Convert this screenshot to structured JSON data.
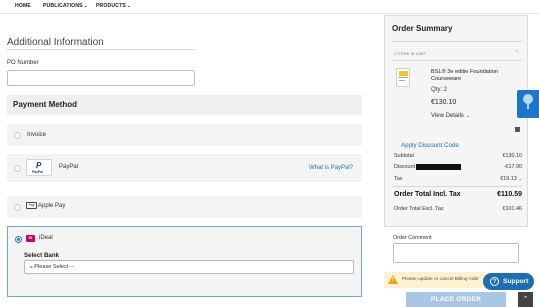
{
  "nav": {
    "home": "HOME",
    "publications": "PUBLICATIONS",
    "products": "PRODUCTS"
  },
  "additional_info": {
    "title": "Additional Information",
    "po_label": "PO Number",
    "po_value": ""
  },
  "payment": {
    "header": "Payment Method",
    "invoice": "Invoice",
    "paypal": "PayPal",
    "paypal_logo_text": "PayPal",
    "what_is_paypal": "What is PayPal?",
    "apple_pay": "Apple Pay",
    "apple_pay_logo": "Pay",
    "ideal": "iDeal",
    "ideal_logo": "iD",
    "select_bank_label": "Select Bank",
    "select_bank_value": "-- Please Select --",
    "selected": "iDeal"
  },
  "order_summary": {
    "title": "Order Summary",
    "items_in_cart": "2 ITEMS IN CART",
    "product": {
      "name": "BSL® 3e editie Foundation Courseware",
      "qty": "Qty: 2",
      "price": "€130.10",
      "view_details": "View Details"
    },
    "discount_link": "Apply Discount Code",
    "subtotal_label": "Subtotal",
    "subtotal_value": "€130.10",
    "discount_label": "Discount",
    "discount_value": "-€17.90",
    "tax_label": "Tax",
    "tax_value": "€19.13",
    "total_incl_label": "Order Total Incl. Tax",
    "total_incl_value": "€110.59",
    "total_excl_label": "Order Total Excl. Tax",
    "total_excl_value": "€101.46"
  },
  "order_comment": {
    "label": "Order Comment",
    "value": ""
  },
  "warning": {
    "text": "Please update or cancel Billing Addr"
  },
  "actions": {
    "place_order": "PLACE ORDER",
    "support": "Support",
    "scroll_top": "⌃"
  },
  "colors": {
    "accent": "#1c6db4",
    "link": "#1b6fb8",
    "ideal": "#cc0066",
    "place_order_disabled": "#a9c7e4",
    "warning_bg": "#fbf2cf"
  }
}
